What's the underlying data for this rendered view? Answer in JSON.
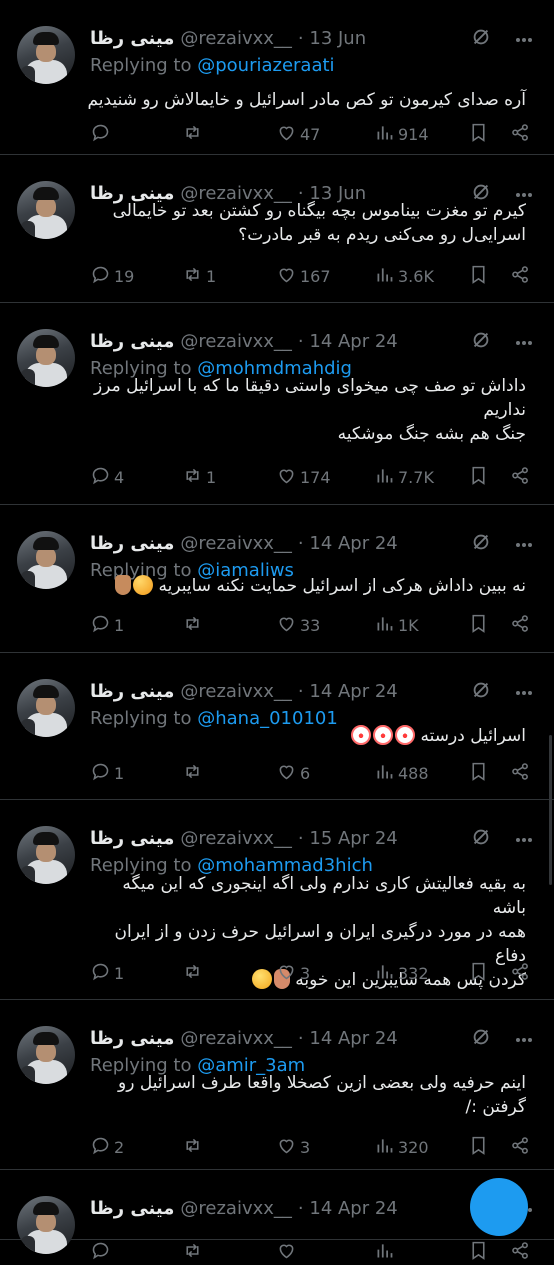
{
  "author": {
    "display_name": "مینی رظا",
    "handle": "@rezaivxx__"
  },
  "labels": {
    "replying_to": "Replying to"
  },
  "colors": {
    "background": "#000000",
    "text": "#e7e9ea",
    "muted": "#71767b",
    "link": "#1d9bf0",
    "divider": "#2f3336"
  },
  "icons": {
    "reply": "comment-icon",
    "retweet": "retweet-icon",
    "like": "heart-icon",
    "views": "bar-chart-icon",
    "bookmark": "bookmark-icon",
    "share": "share-icon",
    "grok": "grok-icon",
    "more": "more-icon"
  },
  "tweets": [
    {
      "date": "· 13 Jun",
      "reply_to": "@pouriazeraati",
      "lines": [
        "آره صدای کیرمون تو کص مادر اسرائیل و خایمالاش رو شنیدیم"
      ],
      "replies": "",
      "retweets": "",
      "likes": "47",
      "views": "914"
    },
    {
      "date": "· 13 Jun",
      "reply_to": "",
      "lines": [
        "کیرم تو مغزت بیناموس بچه بیگناه رو کشتن بعد تو خایمالی",
        "اسرایی‌ل رو می‌کنی ریدم به قبر مادرت؟"
      ],
      "replies": "19",
      "retweets": "1",
      "likes": "167",
      "views": "3.6K"
    },
    {
      "date": "· 14 Apr 24",
      "reply_to": "@mohmdmahdig",
      "lines": [
        "داداش تو صف چی میخوای واستی دقیقا ما که با اسرائیل مرز",
        "نداریم",
        "جنگ هم بشه جنگ موشکیه"
      ],
      "replies": "4",
      "retweets": "1",
      "likes": "174",
      "views": "7.7K"
    },
    {
      "date": "· 14 Apr 24",
      "reply_to": "@iamaliws",
      "lines": [
        "نه ببین داداش هرکی از اسرائیل حمایت نکنه سایبریه"
      ],
      "emoji": [
        "angry",
        "thumb"
      ],
      "replies": "1",
      "retweets": "",
      "likes": "33",
      "views": "1K"
    },
    {
      "date": "· 14 Apr 24",
      "reply_to": "@hana_010101",
      "lines": [
        "اسرائیل درسته"
      ],
      "emoji": [
        "clown",
        "clown",
        "clown"
      ],
      "replies": "1",
      "retweets": "",
      "likes": "6",
      "views": "488"
    },
    {
      "date": "· 15 Apr 24",
      "reply_to": "@mohammad3hich",
      "lines": [
        "به بقیه فعالیتش کاری ندارم ولی اگه اینجوری که این میگه باشه",
        "همه در مورد درگیری ایران و اسرائیل حرف زدن و از ایران دفاع",
        "کردن پس همه سایبرین این خوبه"
      ],
      "emoji": [
        "face",
        "laugh"
      ],
      "replies": "1",
      "retweets": "",
      "likes": "3",
      "views": "332"
    },
    {
      "date": "· 14 Apr 24",
      "reply_to": "@amir_3am",
      "lines": [
        "اینم حرفیه ولی بعضی ازین کصخلا واقعا طرف اسرائیل رو",
        "گرفتن :/"
      ],
      "replies": "2",
      "retweets": "",
      "likes": "3",
      "views": "320"
    },
    {
      "date": "· 14 Apr 24",
      "reply_to": "",
      "lines": [],
      "replies": "",
      "retweets": "",
      "likes": "",
      "views": ""
    }
  ]
}
